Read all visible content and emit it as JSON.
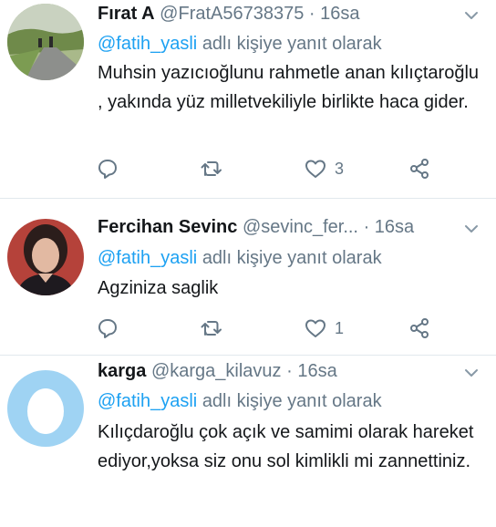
{
  "tweets": [
    {
      "name": "Fırat A",
      "handle": "@FratA56738375",
      "time": "16sa",
      "reply_prefix": "@fatih_yasli",
      "reply_suffix": "adlı kişiye yanıt olarak",
      "text": "Muhsin yazıcıoğlunu rahmetle anan kılıçtaroğlu , yakında yüz milletvekiliyle birlikte haca gider.",
      "likes": "3"
    },
    {
      "name": "Fercihan Sevinc",
      "handle": "@sevinc_fer...",
      "time": "16sa",
      "reply_prefix": "@fatih_yasli",
      "reply_suffix": "adlı kişiye yanıt olarak",
      "text": "Agziniza saglik",
      "likes": "1"
    },
    {
      "name": "karga",
      "handle": "@karga_kilavuz",
      "time": "16sa",
      "reply_prefix": "@fatih_yasli",
      "reply_suffix": "adlı kişiye yanıt olarak",
      "text": "Kılıçdaroğlu çok açık ve samimi olarak hareket ediyor,yoksa siz onu sol kimlikli mi zannettiniz."
    }
  ],
  "separator": "·",
  "icons": {
    "caret": "chevron-down-icon",
    "reply": "reply-icon",
    "retweet": "retweet-icon",
    "like": "heart-icon",
    "share": "share-icon"
  },
  "colors": {
    "link": "#1da1f2",
    "secondary": "#657786",
    "text": "#14171a",
    "divider": "#e1e8ed"
  }
}
